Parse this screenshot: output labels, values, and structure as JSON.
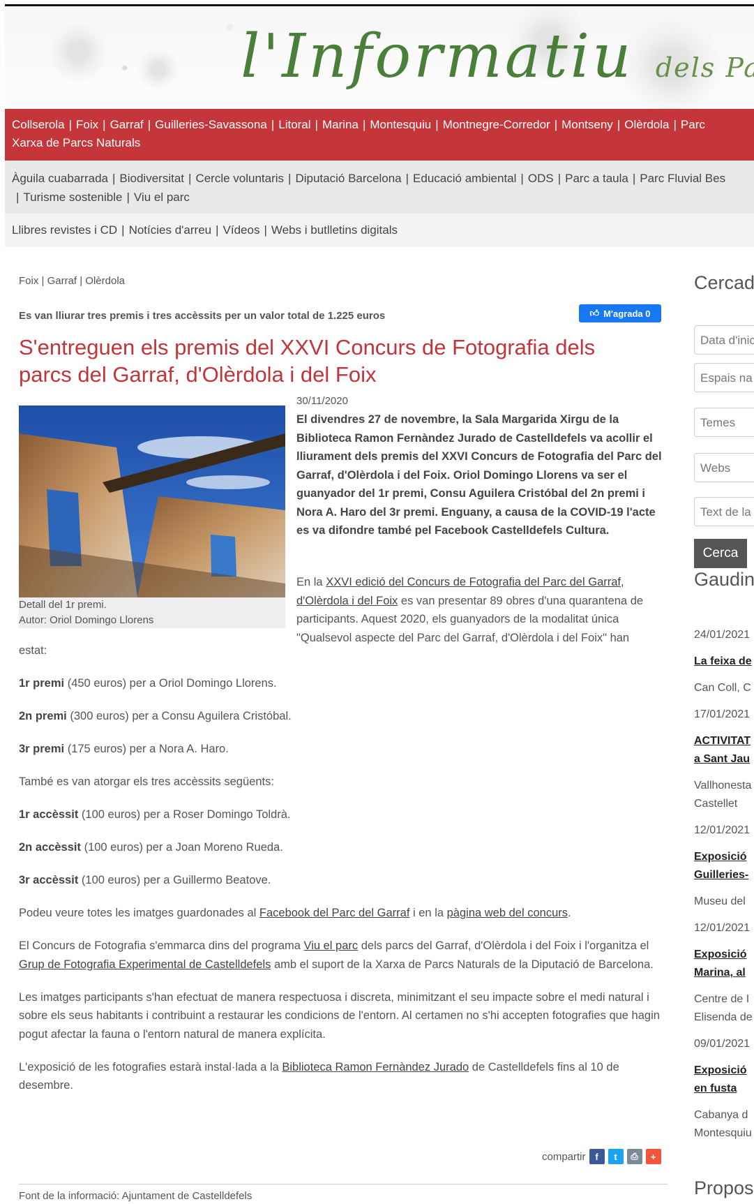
{
  "header": {
    "logo_main": "l'Informatiu",
    "logo_sub": "dels Parcs"
  },
  "nav_red": {
    "items": [
      "Collserola",
      "Foix",
      "Garraf",
      "Guilleries-Savassona",
      "Litoral",
      "Marina",
      "Montesquiu",
      "Montnegre-Corredor",
      "Montseny",
      "Olèrdola",
      "Parc"
    ],
    "line2": "Xarxa de Parcs Naturals"
  },
  "nav_grey": {
    "row1": [
      "Àguila cuabarrada",
      "Biodiversitat",
      "Cercle voluntaris",
      "Diputació Barcelona",
      "Educació ambiental",
      "ODS",
      "Parc a taula",
      "Parc Fluvial Bes"
    ],
    "row2": [
      "Turisme sostenible",
      "Viu el parc"
    ]
  },
  "nav_grey2": {
    "items": [
      "Llibres revistes i CD",
      "Notícies d'arreu",
      "Vídeos",
      "Webs i butlletins digitals"
    ]
  },
  "article": {
    "breadcrumb": "Foix | Garraf | Olèrdola",
    "subtitle": "Es van lliurar tres premis i tres accèssits per un valor total de 1.225 euros",
    "like_label": "M'agrada 0",
    "title": "S'entreguen els premis del XXVI Concurs de Fotografia dels parcs del Garraf, d'Olèrdola i del Foix",
    "date": "30/11/2020",
    "caption_line1": "Detall del 1r premi.",
    "caption_line2": "Autor: Oriol Domingo Llorens",
    "lead": "El divendres 27 de novembre, la Sala Margarida Xirgu de la Biblioteca Ramon Fernàndez Jurado de Castelldefels va acollir el lliurament dels premis del XXVI Concurs de Fotografia del Parc del Garraf, d'Olèrdola i del Foix. Oriol Domingo Llorens va ser el guanyador del 1r premi, Consu Aguilera Cristóbal del 2n premi i Nora A. Haro del 3r premi. Enguany, a causa de la COVID-19 l'acte es va difondre també pel Facebook Castelldefels Cultura.",
    "p1_pre": "En la ",
    "p1_link": "XXVI edició del Concurs de Fotografia del Parc del Garraf, d'Olèrdola i del Foix",
    "p1_post": " es van presentar 89 obres d'una quarantena de participants. Aquest 2020, els guanyadors de la modalitat única \"Qualsevol aspecte del Parc del Garraf, d'Olèrdola i del Foix\" han",
    "p1_cont": "estat:",
    "prizes": [
      {
        "label": "1r premi",
        "text": " (450 euros) per a Oriol Domingo Llorens."
      },
      {
        "label": "2n premi",
        "text": " (300 euros) per a Consu Aguilera Cristóbal."
      },
      {
        "label": "3r premi",
        "text": " (175 euros) per a Nora A. Haro."
      }
    ],
    "accessits_intro": "També es van atorgar els tres accèssits següents:",
    "accessits": [
      {
        "label": "1r accèssit",
        "text": " (100 euros) per a Roser Domingo Toldrà."
      },
      {
        "label": "2n accèssit",
        "text": " (100 euros) per a Joan Moreno Rueda."
      },
      {
        "label": "3r accèssit",
        "text": " (100 euros) per a Guillermo Beatove."
      }
    ],
    "p_links_pre": "Podeu veure totes les imatges guardonades al ",
    "p_links_a": "Facebook del Parc del Garraf",
    "p_links_mid": " i en la ",
    "p_links_b": "pàgina web del concurs",
    "p_links_post": ".",
    "p_prog_pre": "El Concurs de Fotografia s'emmarca dins del programa ",
    "p_prog_a": "Viu el parc",
    "p_prog_mid": " dels parcs del Garraf, d'Olèrdola i del Foix i l'organitza el ",
    "p_prog_b": "Grup de Fotografia Experimental de Castelldefels",
    "p_prog_post": " amb el suport de  la Xarxa de Parcs Naturals de la Diputació de Barcelona.",
    "p_resp": "Les imatges participants s'han efectuat de manera respectuosa i discreta, minimitzant el seu impacte sobre el medi natural i sobre els seus habitants i contribuint a restaurar les condicions de l'entorn. Al certamen no s'hi accepten fotografies que hagin pogut afectar la fauna o l'entorn natural de manera explícita.",
    "p_expo_pre": "L'exposició de les fotografies estarà instal·lada a la ",
    "p_expo_a": "Biblioteca Ramon Fernàndez Jurado",
    "p_expo_post": " de Castelldefels fins al 10 de desembre.",
    "share_label": "compartir",
    "source": "Font de la informació: Ajuntament de Castelldefels"
  },
  "sidebar": {
    "search_title": "Cercad",
    "fields": [
      "Data d'inic",
      "Espais na",
      "Temes",
      "Webs",
      "Text de la"
    ],
    "search_button": "Cerca",
    "events_title": "Gaudin",
    "events": [
      {
        "date": "24/01/2021",
        "title": [
          "La feixa de"
        ],
        "place": [
          "Can Coll, C"
        ]
      },
      {
        "date": "17/01/2021",
        "title": [
          "ACTIVITAT",
          "a Sant Jau"
        ],
        "place": [
          "Vallhonesta",
          "Castellet"
        ]
      },
      {
        "date": "12/01/2021",
        "title": [
          "Exposició",
          "Guilleries-"
        ],
        "place": [
          "Museu del"
        ]
      },
      {
        "date": "12/01/2021",
        "title": [
          "Exposició",
          "Marina, al"
        ],
        "place": [
          "Centre de I",
          "Elisenda de"
        ]
      },
      {
        "date": "09/01/2021",
        "title": [
          "Exposició",
          "en fusta"
        ],
        "place": [
          "Cabanya d",
          "Montesquiu"
        ]
      }
    ],
    "bottom_title": "Propos"
  },
  "colors": {
    "brand_red": "#c5363a",
    "title_red": "#c0353a",
    "facebook": "#1877f2"
  }
}
